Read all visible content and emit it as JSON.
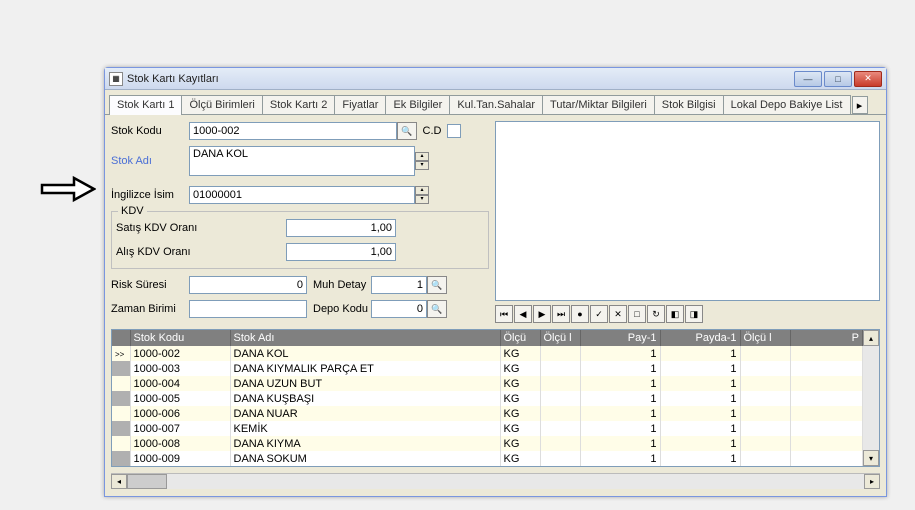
{
  "window": {
    "title": "Stok Kartı Kayıtları"
  },
  "tabs": [
    "Stok Kartı 1",
    "Ölçü Birimleri",
    "Stok Kartı 2",
    "Fiyatlar",
    "Ek Bilgiler",
    "Kul.Tan.Sahalar",
    "Tutar/Miktar Bilgileri",
    "Stok Bilgisi",
    "Lokal Depo Bakiye List"
  ],
  "form": {
    "stok_kodu_lbl": "Stok Kodu",
    "stok_kodu_val": "1000-002",
    "cd_lbl": "C.D",
    "stok_adi_lbl": "Stok Adı",
    "stok_adi_val": "DANA KOL",
    "ing_lbl": "İngilizce İsim",
    "ing_val": "01000001",
    "kdv_lbl": "KDV",
    "satis_kdv_lbl": "Satış KDV Oranı",
    "satis_kdv_val": "1,00",
    "alis_kdv_lbl": "Alış KDV Oranı",
    "alis_kdv_val": "1,00",
    "risk_lbl": "Risk Süresi",
    "risk_val": "0",
    "muh_lbl": "Muh Detay",
    "muh_val": "1",
    "zaman_lbl": "Zaman Birimi",
    "zaman_val": "",
    "depo_lbl": "Depo Kodu",
    "depo_val": "0"
  },
  "grid": {
    "headers": [
      "Stok Kodu",
      "Stok Adı",
      "Ölçü",
      "Ölçü l",
      "Pay-1",
      "Payda-1",
      "Ölçü l",
      "P"
    ],
    "rows": [
      {
        "kod": "1000-002",
        "adi": "DANA KOL",
        "o": "KG",
        "o2": "",
        "p": "1",
        "pd": "1",
        "o3": "",
        "p2": ""
      },
      {
        "kod": "1000-003",
        "adi": "DANA KIYMALIK PARÇA ET",
        "o": "KG",
        "o2": "",
        "p": "1",
        "pd": "1",
        "o3": "",
        "p2": ""
      },
      {
        "kod": "1000-004",
        "adi": "DANA UZUN BUT",
        "o": "KG",
        "o2": "",
        "p": "1",
        "pd": "1",
        "o3": "",
        "p2": ""
      },
      {
        "kod": "1000-005",
        "adi": "DANA KUŞBAŞI",
        "o": "KG",
        "o2": "",
        "p": "1",
        "pd": "1",
        "o3": "",
        "p2": ""
      },
      {
        "kod": "1000-006",
        "adi": "DANA NUAR",
        "o": "KG",
        "o2": "",
        "p": "1",
        "pd": "1",
        "o3": "",
        "p2": ""
      },
      {
        "kod": "1000-007",
        "adi": "KEMİK",
        "o": "KG",
        "o2": "",
        "p": "1",
        "pd": "1",
        "o3": "",
        "p2": ""
      },
      {
        "kod": "1000-008",
        "adi": "DANA KIYMA",
        "o": "KG",
        "o2": "",
        "p": "1",
        "pd": "1",
        "o3": "",
        "p2": ""
      },
      {
        "kod": "1000-009",
        "adi": "DANA SOKUM",
        "o": "KG",
        "o2": "",
        "p": "1",
        "pd": "1",
        "o3": "",
        "p2": ""
      }
    ]
  }
}
